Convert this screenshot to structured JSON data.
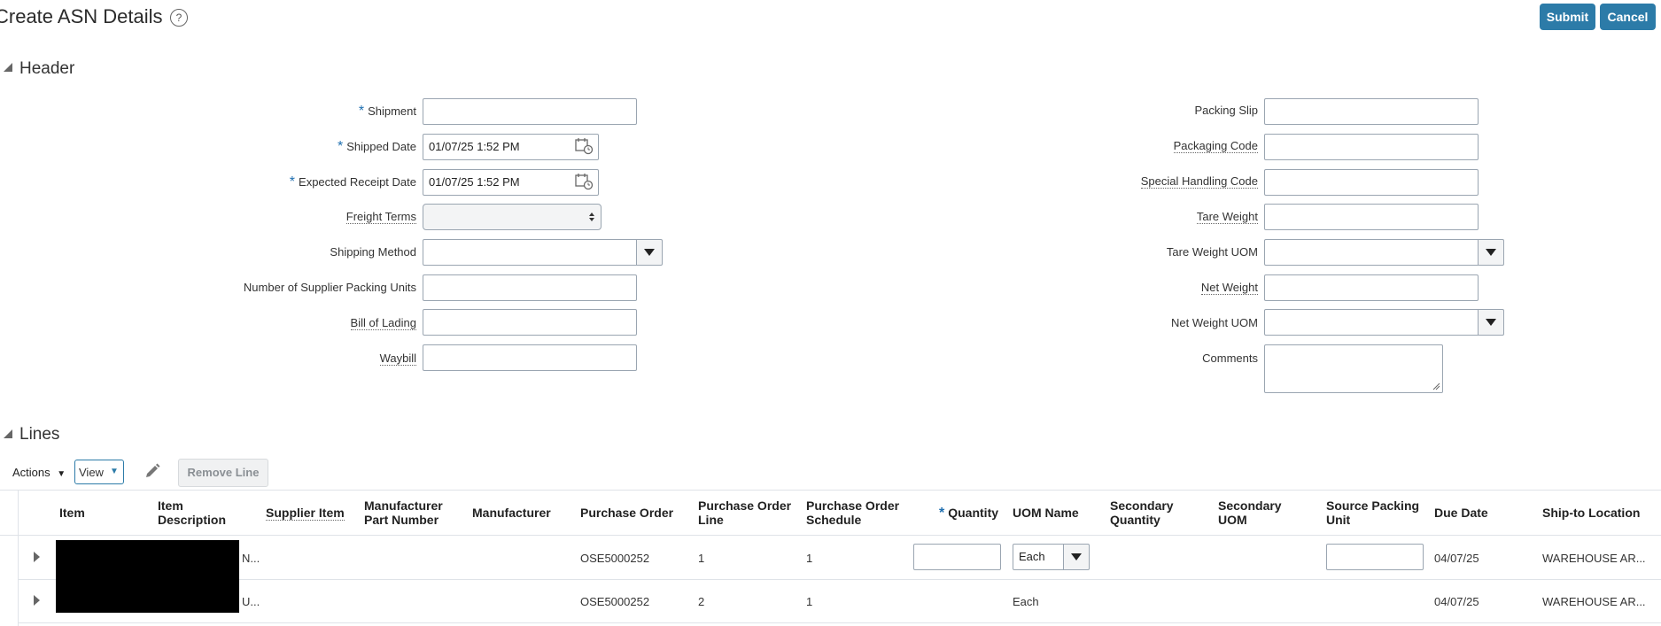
{
  "page": {
    "title": "Create ASN Details",
    "help_icon": "?"
  },
  "actions": {
    "submit": "Submit",
    "cancel": "Cancel"
  },
  "header_section": {
    "title": "Header",
    "left_fields": {
      "shipment": {
        "label": "Shipment",
        "required": true,
        "value": ""
      },
      "shipped_date": {
        "label": "Shipped Date",
        "required": true,
        "value": "01/07/25 1:52 PM"
      },
      "expected_receipt_date": {
        "label": "Expected Receipt Date",
        "required": true,
        "value": "01/07/25 1:52 PM"
      },
      "freight_terms": {
        "label": "Freight Terms",
        "value": ""
      },
      "shipping_method": {
        "label": "Shipping Method",
        "value": ""
      },
      "supplier_packing_units": {
        "label": "Number of Supplier Packing Units",
        "value": ""
      },
      "bill_of_lading": {
        "label": "Bill of Lading",
        "value": ""
      },
      "waybill": {
        "label": "Waybill",
        "value": ""
      }
    },
    "right_fields": {
      "packing_slip": {
        "label": "Packing Slip",
        "value": ""
      },
      "packaging_code": {
        "label": "Packaging Code",
        "value": ""
      },
      "special_handling_code": {
        "label": "Special Handling Code",
        "value": ""
      },
      "tare_weight": {
        "label": "Tare Weight",
        "value": ""
      },
      "tare_weight_uom": {
        "label": "Tare Weight UOM",
        "value": ""
      },
      "net_weight": {
        "label": "Net Weight",
        "value": ""
      },
      "net_weight_uom": {
        "label": "Net Weight UOM",
        "value": ""
      },
      "comments": {
        "label": "Comments",
        "value": ""
      }
    }
  },
  "lines_section": {
    "title": "Lines",
    "toolbar": {
      "actions": "Actions",
      "view": "View",
      "remove_line": "Remove Line"
    },
    "columns": {
      "item": "Item",
      "item_description_1": "Item",
      "item_description_2": "Description",
      "supplier_item": "Supplier Item",
      "mfr_part_1": "Manufacturer",
      "mfr_part_2": "Part Number",
      "manufacturer": "Manufacturer",
      "purchase_order": "Purchase Order",
      "po_line_1": "Purchase Order",
      "po_line_2": "Line",
      "po_schedule_1": "Purchase Order",
      "po_schedule_2": "Schedule",
      "quantity": "Quantity",
      "uom_name": "UOM Name",
      "sec_qty_1": "Secondary",
      "sec_qty_2": "Quantity",
      "sec_uom_1": "Secondary",
      "sec_uom_2": "UOM",
      "source_pu_1": "Source Packing",
      "source_pu_2": "Unit",
      "due_date": "Due Date",
      "ship_to": "Ship-to Location"
    },
    "rows": [
      {
        "desc_tail": "N...",
        "purchase_order": "OSE5000252",
        "po_line": "1",
        "po_schedule": "1",
        "quantity": "",
        "uom": "Each",
        "source_packing_unit": "",
        "due_date": "04/07/25",
        "ship_to": "WAREHOUSE AR..."
      },
      {
        "desc_tail": "U...",
        "purchase_order": "OSE5000252",
        "po_line": "2",
        "po_schedule": "1",
        "uom": "Each",
        "due_date": "04/07/25",
        "ship_to": "WAREHOUSE AR..."
      }
    ]
  }
}
